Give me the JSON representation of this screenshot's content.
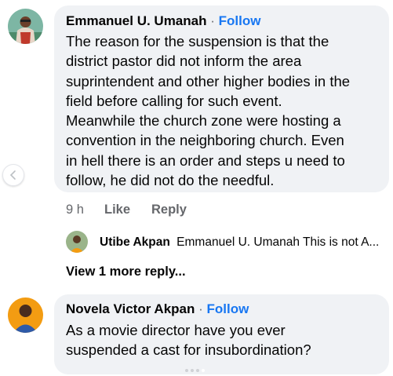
{
  "comments": [
    {
      "author": "Emmanuel U. Umanah",
      "separator": "·",
      "follow_label": "Follow",
      "text_lines": [
        "The reason for the suspension is that the",
        "district pastor did not inform the area",
        "suprintendent and other higher bodies in the",
        "field before calling for such event.",
        "Meanwhile the church zone were hosting a",
        "convention in the neighboring church. Even",
        "in hell there is an order and steps u need to",
        "follow, he did not do the needful."
      ],
      "time": "9 h",
      "like_label": "Like",
      "reply_label": "Reply",
      "reply_preview": {
        "author": "Utibe Akpan",
        "text": "Emmanuel U. Umanah This is not A..."
      },
      "more_replies_label": "View 1 more reply..."
    },
    {
      "author": "Novela Victor Akpan",
      "separator": "·",
      "follow_label": "Follow",
      "text_lines": [
        "As a movie director  have  you ever",
        "suspended a cast for insubordination?"
      ]
    }
  ],
  "colors": {
    "accent": "#1877f2",
    "bubble": "#f0f2f5",
    "muted": "#65676b"
  },
  "icons": {
    "scroll_left": "chevron-left-icon"
  }
}
